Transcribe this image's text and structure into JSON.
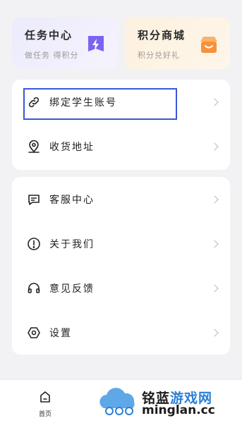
{
  "cards": {
    "task": {
      "title": "任务中心",
      "subtitle": "做任务 得积分",
      "icon": "lightning-badge-icon",
      "color": "#7b63f2"
    },
    "mall": {
      "title": "积分商城",
      "subtitle": "积分兑好礼",
      "icon": "shop-icon",
      "color": "#f7913a"
    }
  },
  "menu_group_1": [
    {
      "label": "绑定学生账号",
      "icon": "link-icon"
    },
    {
      "label": "收货地址",
      "icon": "location-pin-icon"
    }
  ],
  "menu_group_2": [
    {
      "label": "客服中心",
      "icon": "message-icon"
    },
    {
      "label": "关于我们",
      "icon": "info-icon"
    },
    {
      "label": "意见反馈",
      "icon": "headset-icon"
    },
    {
      "label": "设置",
      "icon": "hexagon-gear-icon"
    }
  ],
  "tabbar": {
    "home_label": "首页"
  },
  "watermark": {
    "cn_black": "铭蓝",
    "cn_blue": "游戏网",
    "domain": "minglan.cc"
  },
  "colors": {
    "highlight": "#3a57d6",
    "accent_blue": "#2a7fd6"
  }
}
